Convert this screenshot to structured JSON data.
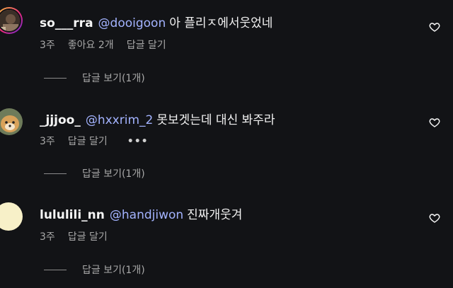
{
  "comments": [
    {
      "username": "so___rra",
      "mention": "@dooigoon",
      "text": "아 플리ㅈ에서웃었네",
      "time": "3주",
      "likes": "좋아요 2개",
      "reply": "답글 달기",
      "view_replies": "답글 보기(1개)",
      "avatar_icon": "profile-photo"
    },
    {
      "username": "_jjjoo_",
      "mention": "@hxxrim_2",
      "text": "못보겟는데 대신 봐주라",
      "time": "3주",
      "reply": "답글 달기",
      "more": "•••",
      "view_replies": "답글 보기(1개)",
      "avatar_icon": "dog-photo"
    },
    {
      "username": "lululili_nn",
      "mention": "@handjiwon",
      "text": "진짜개웃겨",
      "time": "3주",
      "reply": "답글 달기",
      "view_replies": "답글 보기(1개)",
      "avatar_icon": "blank-avatar"
    }
  ],
  "colors": {
    "background": "#121316",
    "mention": "#a3b3ff",
    "muted": "#a8a8a8"
  }
}
